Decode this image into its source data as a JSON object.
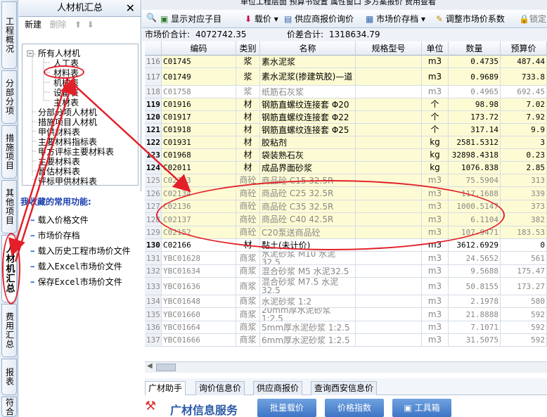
{
  "vtabs": [
    "工程概况",
    "分部分项",
    "措施项目",
    "其他项目",
    "人材机汇总",
    "费用汇总",
    "报表",
    "符合"
  ],
  "panel": {
    "title": "人材机汇总",
    "close": "✕",
    "new": "新建",
    "delete": "删除",
    "up": "⬆",
    "down": "⬇"
  },
  "tree": [
    "所有人材机",
    "人工表",
    "材料表",
    "机械表",
    "设备表",
    "主材表",
    "分部分项人材机",
    "措施项目人材机",
    "甲供材料表",
    "主要材料指标表",
    "甲方评标主要材料表",
    "主要材料表",
    "暂估材料表",
    "评标甲供材料表"
  ],
  "favorites": {
    "title": "我收藏的常用功能:",
    "items": [
      "载入价格文件",
      "市场价存档",
      "载入历史工程市场价文件",
      "载入Excel市场价文件",
      "保存Excel市场价文件"
    ]
  },
  "topstrip": "单位工程层面    预算书设置    属性窗口    多方案报价    费用查看",
  "toolbar": [
    "显示对应子目",
    "载价 ▾",
    "供应商报价询价",
    "市场价存档 ▾",
    "调整市场价系数",
    "锁定"
  ],
  "summary": {
    "market_label": "市场价合计:",
    "market_value": "4072742.35",
    "diff_label": "价差合计:",
    "diff_value": "1318634.79"
  },
  "columns": [
    "",
    "编码",
    "类别",
    "名称",
    "规格型号",
    "单位",
    "数量",
    "预算价"
  ],
  "rows": [
    {
      "n": "116",
      "code": "C01745",
      "cat": "浆",
      "name": "素水泥浆",
      "spec": "",
      "unit": "m3",
      "qty": "0.4735",
      "price": "487.44",
      "style": "y"
    },
    {
      "n": "117",
      "code": "C01749",
      "cat": "浆",
      "name": "素水泥浆(掺建筑胶)—道",
      "spec": "",
      "unit": "m3",
      "qty": "0.9689",
      "price": "733.8",
      "style": "y"
    },
    {
      "n": "118",
      "code": "C01758",
      "cat": "浆",
      "name": "纸筋石灰浆",
      "spec": "",
      "unit": "m3",
      "qty": "0.4965",
      "price": "692.45",
      "style": "g"
    },
    {
      "n": "119",
      "code": "C01916",
      "cat": "材",
      "name": "钢筋直螺纹连接套 Φ20",
      "spec": "",
      "unit": "个",
      "qty": "98.98",
      "price": "7.02",
      "style": "yb"
    },
    {
      "n": "120",
      "code": "C01917",
      "cat": "材",
      "name": "钢筋直螺纹连接套 Φ22",
      "spec": "",
      "unit": "个",
      "qty": "173.72",
      "price": "7.92",
      "style": "yb"
    },
    {
      "n": "121",
      "code": "C01918",
      "cat": "材",
      "name": "钢筋直螺纹连接套 Φ25",
      "spec": "",
      "unit": "个",
      "qty": "317.14",
      "price": "9.9",
      "style": "yb"
    },
    {
      "n": "122",
      "code": "C01931",
      "cat": "材",
      "name": "胶粘剂",
      "spec": "",
      "unit": "kg",
      "qty": "2581.5312",
      "price": "3",
      "style": "yb"
    },
    {
      "n": "123",
      "code": "C01968",
      "cat": "材",
      "name": "袋装熟石灰",
      "spec": "",
      "unit": "kg",
      "qty": "32898.4318",
      "price": "0.23",
      "style": "yb"
    },
    {
      "n": "124",
      "code": "C02011",
      "cat": "材",
      "name": "成品界面砂浆",
      "spec": "",
      "unit": "kg",
      "qty": "1076.838",
      "price": "2.85",
      "style": "yb"
    },
    {
      "n": "125",
      "code": "C02133",
      "cat": "商砼",
      "name": "商品砼 C15 32.5R",
      "spec": "",
      "unit": "m3",
      "qty": "75.5904",
      "price": "313",
      "style": "yg"
    },
    {
      "n": "126",
      "code": "C02134",
      "cat": "商砼",
      "name": "商品砼 C25 32.5R",
      "spec": "",
      "unit": "m3",
      "qty": "117.1688",
      "price": "339",
      "style": "yg"
    },
    {
      "n": "127",
      "code": "C02136",
      "cat": "商砼",
      "name": "商品砼 C35 32.5R",
      "spec": "",
      "unit": "m3",
      "qty": "1000.5147",
      "price": "373",
      "style": "yg"
    },
    {
      "n": "128",
      "code": "C02137",
      "cat": "商砼",
      "name": "商品砼 C40 42.5R",
      "spec": "",
      "unit": "m3",
      "qty": "6.1104",
      "price": "382",
      "style": "yg"
    },
    {
      "n": "129",
      "code": "C02152",
      "cat": "商砼",
      "name": "C20泵送商品砼",
      "spec": "",
      "unit": "m3",
      "qty": "107.9471",
      "price": "183.53",
      "style": "yg"
    },
    {
      "n": "130",
      "code": "C02166",
      "cat": "材",
      "name": "黏土(未计价)",
      "spec": "",
      "unit": "m3",
      "qty": "3612.6929",
      "price": "0",
      "style": "b"
    },
    {
      "n": "131",
      "code": "YBC01628",
      "cat": "商浆",
      "name": "水泥砂浆 M10 水泥32.5",
      "spec": "",
      "unit": "m3",
      "qty": "24.5652",
      "price": "561",
      "style": "g"
    },
    {
      "n": "132",
      "code": "YBC01634",
      "cat": "商浆",
      "name": "混合砂浆 M5 水泥32.5",
      "spec": "",
      "unit": "m3",
      "qty": "9.5688",
      "price": "175.47",
      "style": "g"
    },
    {
      "n": "133",
      "code": "YBC01636",
      "cat": "商浆",
      "name": "混合砂浆 M7.5 水泥32.5",
      "spec": "",
      "unit": "m3",
      "qty": "50.8155",
      "price": "173.27",
      "style": "g"
    },
    {
      "n": "134",
      "code": "YBC01648",
      "cat": "商浆",
      "name": "水泥砂浆 1:2",
      "spec": "",
      "unit": "m3",
      "qty": "2.1978",
      "price": "580",
      "style": "g"
    },
    {
      "n": "135",
      "code": "YBC01660",
      "cat": "商浆",
      "name": "20mm厚水泥砂浆 1:2.5",
      "spec": "",
      "unit": "m3",
      "qty": "21.8888",
      "price": "592",
      "style": "g"
    },
    {
      "n": "136",
      "code": "YBC01664",
      "cat": "商浆",
      "name": "5mm厚水泥砂浆 1:2.5",
      "spec": "",
      "unit": "m3",
      "qty": "7.1071",
      "price": "592",
      "style": "g"
    },
    {
      "n": "137",
      "code": "YBC01666",
      "cat": "商浆",
      "name": "6mm厚水泥砂浆 1:2.5",
      "spec": "",
      "unit": "m3",
      "qty": "31.5075",
      "price": "592",
      "style": "g"
    }
  ],
  "bottom_tabs": [
    "广材助手",
    "询价信息价",
    "供应商报价",
    "查询西安信息价"
  ],
  "footer": {
    "brand": "广材信息服务",
    "btn1": "批量载价",
    "btn2": "价格指数",
    "btn3": "工具箱"
  },
  "colors": {
    "annotation": "#e3202a",
    "highlight_row": "#fdfbd3",
    "accent": "#3f75c6"
  }
}
